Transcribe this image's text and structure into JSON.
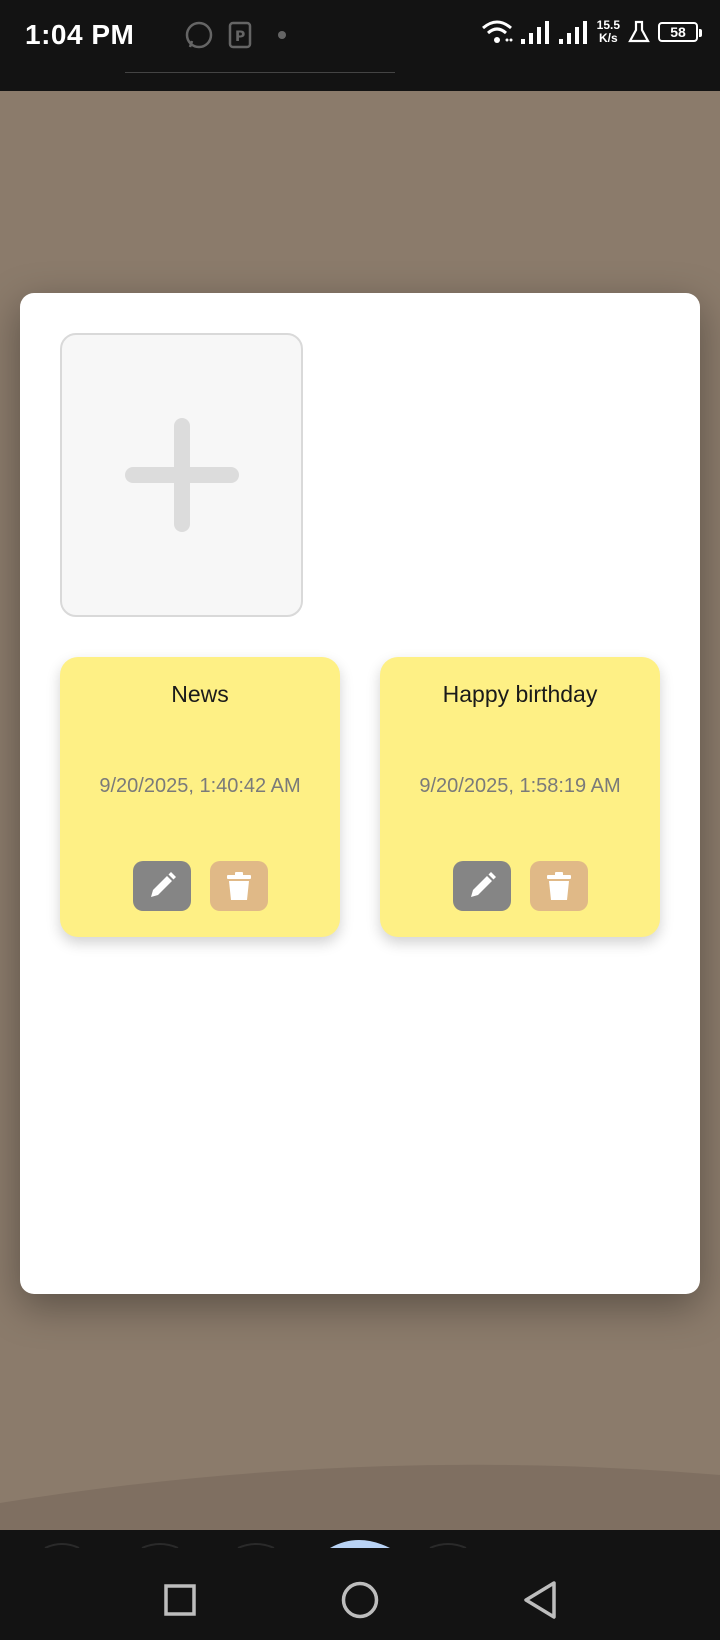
{
  "status_bar": {
    "time": "1:04 PM",
    "net_speed_value": "15.5",
    "net_speed_unit": "K/s",
    "battery": "58",
    "icons": [
      "whatsapp-icon",
      "app-icon",
      "dot-icon",
      "wifi-icon",
      "signal-icon",
      "signal-icon",
      "lab-icon",
      "battery-icon"
    ]
  },
  "add_tile": {
    "icon": "plus-icon"
  },
  "notes": [
    {
      "title": "News",
      "date": "9/20/2025, 1:40:42 AM"
    },
    {
      "title": "Happy birthday",
      "date": "9/20/2025, 1:58:19 AM"
    }
  ],
  "colors": {
    "card": "#fef085",
    "edit_button": "#858585",
    "delete_button": "#e0b987",
    "backdrop": "#8b7b6b"
  },
  "nav_bar": {
    "buttons": [
      "recents-icon",
      "home-icon",
      "back-icon"
    ]
  }
}
